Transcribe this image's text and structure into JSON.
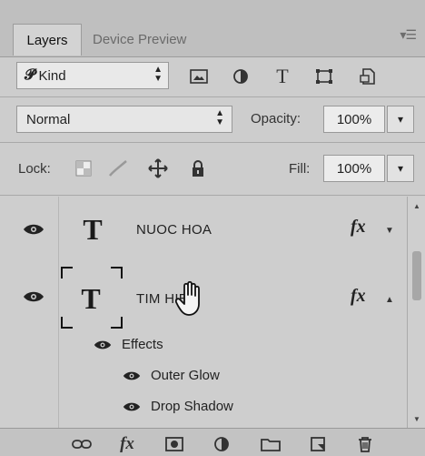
{
  "tabs": [
    {
      "label": "Layers"
    },
    {
      "label": "Device Preview"
    }
  ],
  "panel_menu_icon": "panel-menu-icon",
  "filter": {
    "kind_label": "Kind",
    "icons": [
      "image-filter-icon",
      "adjustment-filter-icon",
      "type-filter-icon",
      "shape-filter-icon",
      "smart-object-filter-icon"
    ]
  },
  "blend": {
    "mode": "Normal",
    "opacity_label": "Opacity:",
    "opacity_value": "100%",
    "fill_label": "Fill:",
    "fill_value": "100%"
  },
  "lock": {
    "label": "Lock:",
    "icons": [
      "lock-transparent-pixels-icon",
      "lock-image-pixels-icon",
      "lock-position-icon",
      "lock-all-icon"
    ]
  },
  "layers": [
    {
      "name": "NUOC HOA",
      "thumb": "T",
      "fx": "fx",
      "expanded": false
    },
    {
      "name": "TIM HIEU",
      "thumb": "T",
      "fx": "fx",
      "expanded": true
    }
  ],
  "effects": {
    "label": "Effects",
    "items": [
      "Outer Glow",
      "Drop Shadow"
    ]
  },
  "bottom_icons": [
    "link-layers-icon",
    "fx-icon",
    "add-mask-icon",
    "adjustment-layer-icon",
    "group-folder-icon",
    "new-layer-icon",
    "trash-icon"
  ],
  "bottom_fx_label": "fx"
}
